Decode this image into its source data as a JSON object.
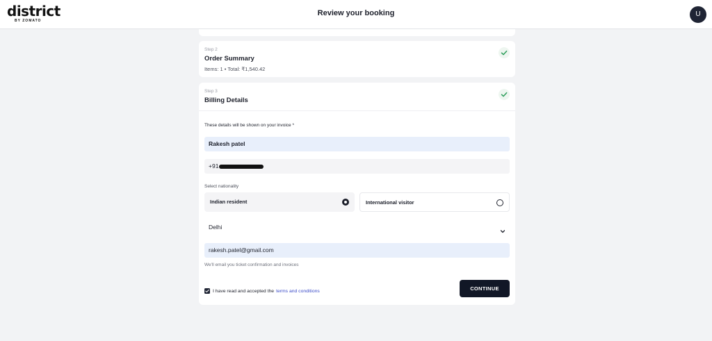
{
  "header": {
    "logo_text": "district",
    "logo_sub": "BY ZOMATO",
    "title": "Review your booking",
    "avatar_initial": "U"
  },
  "order_step": {
    "step_label": "Step 2",
    "title": "Order Summary",
    "summary": "Items: 1 • Total: ₹1,540.42",
    "icon": "check-icon"
  },
  "billing_step": {
    "step_label": "Step 3",
    "title": "Billing Details",
    "icon": "check-icon",
    "invoice_note": "These details will be shown on your invoice *",
    "name_value": "Rakesh patel",
    "phone_prefix": "+91",
    "nationality_label": "Select nationality",
    "nationality_options": [
      {
        "label": "Indian resident",
        "selected": true
      },
      {
        "label": "International visitor",
        "selected": false
      }
    ],
    "state_value": "Delhi",
    "email_value": "rakesh.patel@gmail.com",
    "email_note": "We'll email you ticket confirmation and invoices",
    "terms_prefix": "I have read and accepted the",
    "terms_link": "terms and conditions",
    "terms_checked": true,
    "continue_label": "CONTINUE"
  },
  "colors": {
    "accent_dark": "#111726",
    "link": "#3b4bc8",
    "check_green": "#2e9e5b",
    "input_fill": "#e8effb"
  }
}
